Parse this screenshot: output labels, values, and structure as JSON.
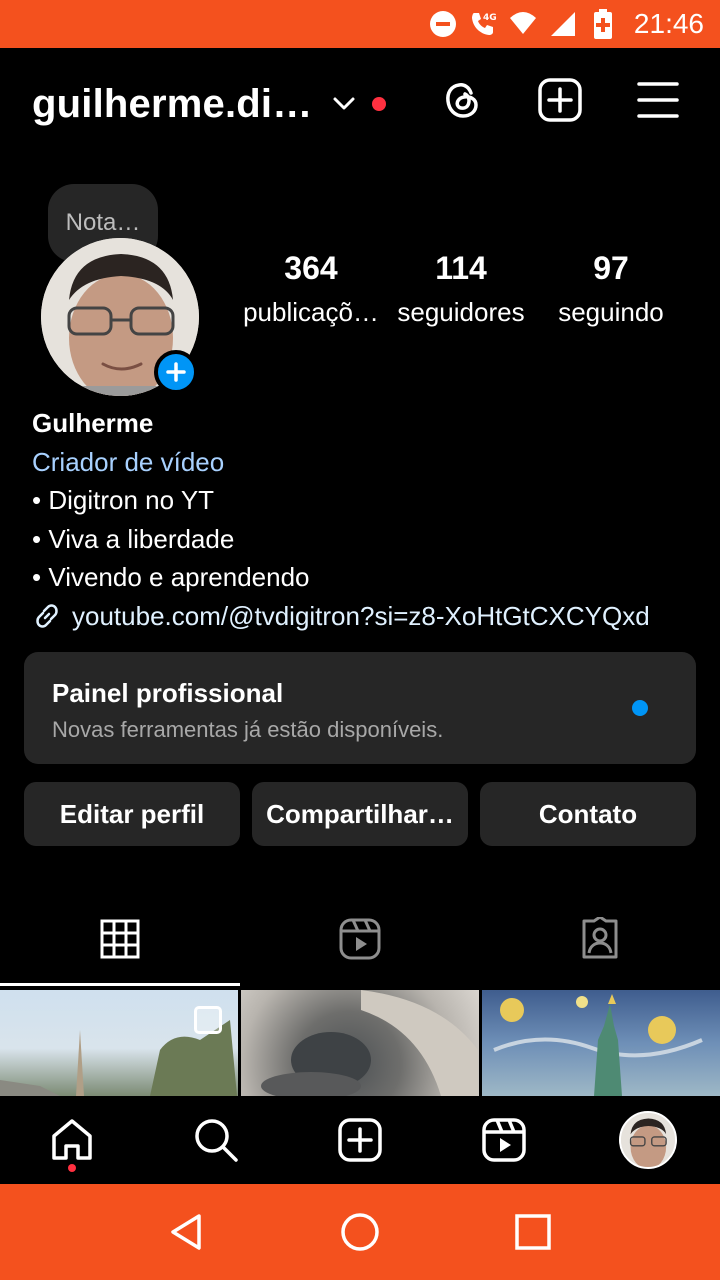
{
  "status_bar": {
    "time": "21:46",
    "network": "4G"
  },
  "header": {
    "username": "guilherme.di…"
  },
  "note": {
    "text": "Nota…"
  },
  "stats": [
    {
      "value": "364",
      "label": "publicaçõ…"
    },
    {
      "value": "114",
      "label": "seguidores"
    },
    {
      "value": "97",
      "label": "seguindo"
    }
  ],
  "bio": {
    "name": "Gulherme",
    "category": "Criador de vídeo",
    "lines": [
      "• Digitron no YT",
      "• Viva a liberdade",
      "• Vivendo e aprendendo"
    ],
    "link": "youtube.com/@tvdigitron?si=z8-XoHtGtCXCYQxd"
  },
  "pro_panel": {
    "title": "Painel profissional",
    "subtitle": "Novas ferramentas já estão disponíveis."
  },
  "buttons": {
    "edit": "Editar perfil",
    "share": "Compartilhar…",
    "contact": "Contato"
  },
  "colors": {
    "accent": "#0095f6",
    "status_bar": "#f4511e",
    "notification": "#ff3040",
    "panel": "#262626"
  },
  "icons": [
    "threads-icon",
    "create-icon",
    "menu-icon",
    "grid-icon",
    "reels-icon",
    "tagged-icon",
    "home-icon",
    "search-icon",
    "reels-nav-icon"
  ]
}
